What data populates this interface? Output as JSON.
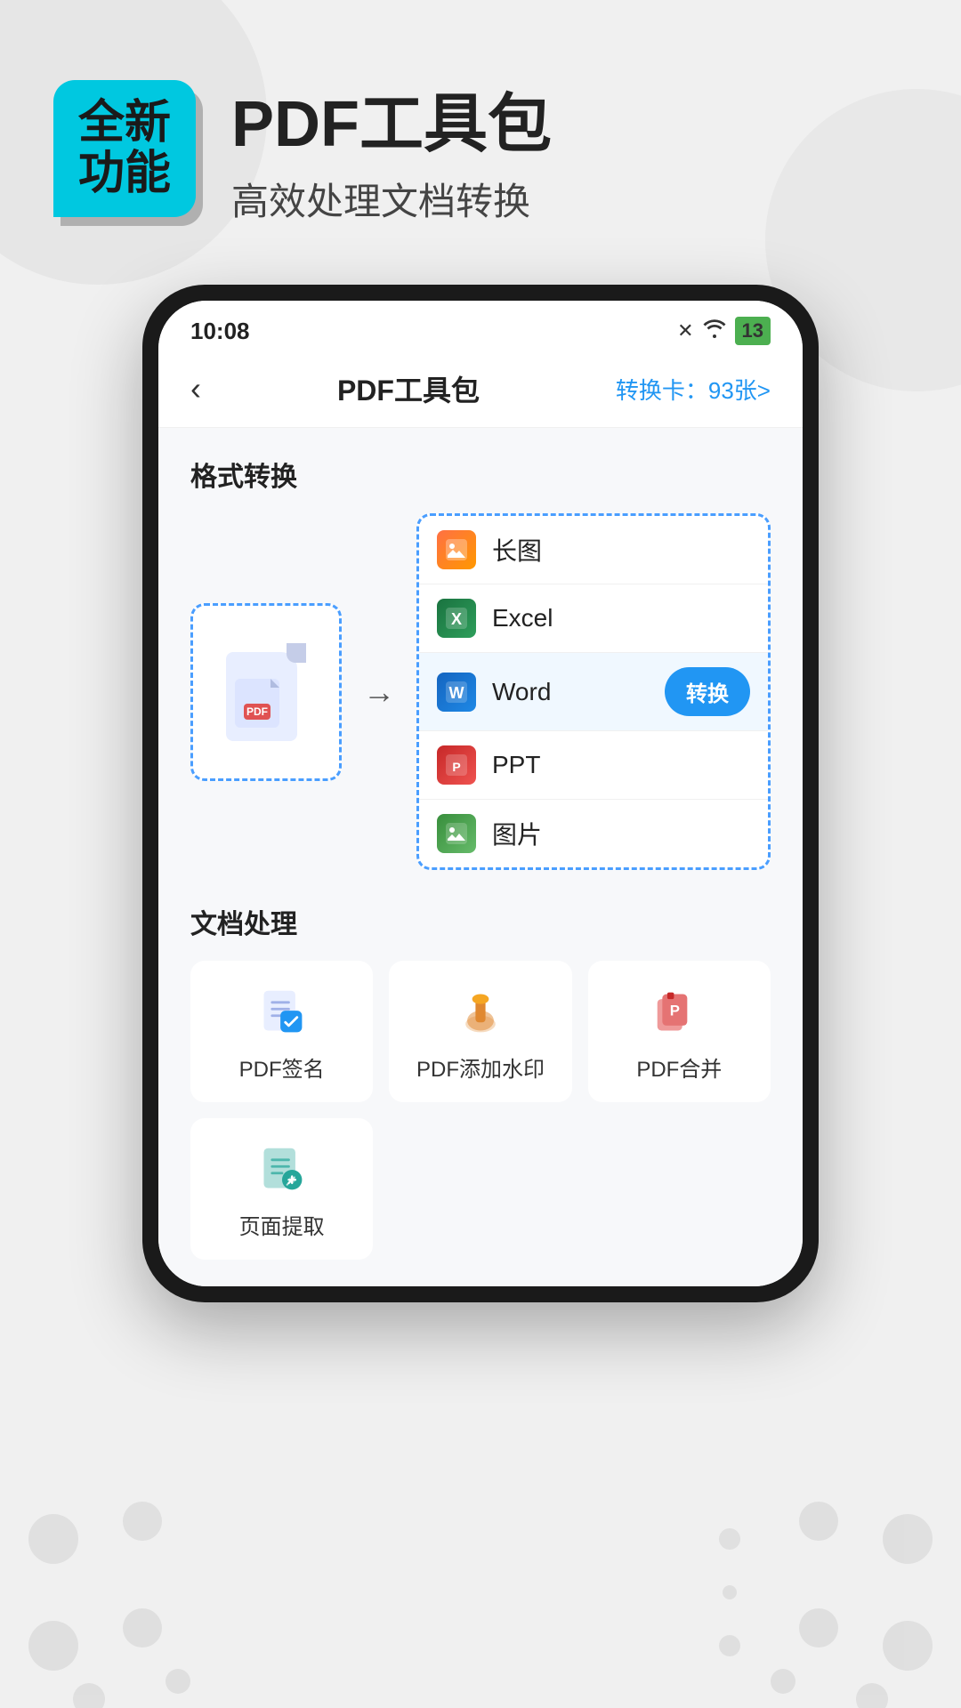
{
  "background": {
    "color": "#efefef"
  },
  "header": {
    "badge_line1": "全新",
    "badge_line2": "功能",
    "title": "PDF工具包",
    "subtitle": "高效处理文档转换"
  },
  "status_bar": {
    "time": "10:08",
    "battery": "13"
  },
  "nav": {
    "back_label": "‹",
    "title": "PDF工具包",
    "action": "转换卡：93张>"
  },
  "format_section": {
    "title": "格式转换",
    "source_label": "PDF",
    "formats": [
      {
        "id": "image",
        "name": "长图",
        "icon_type": "image"
      },
      {
        "id": "excel",
        "name": "Excel",
        "icon_type": "excel"
      },
      {
        "id": "word",
        "name": "Word",
        "icon_type": "word",
        "active": true,
        "action": "转换"
      },
      {
        "id": "ppt",
        "name": "PPT",
        "icon_type": "ppt"
      },
      {
        "id": "picture",
        "name": "图片",
        "icon_type": "picture"
      }
    ]
  },
  "doc_section": {
    "title": "文档处理",
    "tools": [
      {
        "id": "sign",
        "name": "PDF签名",
        "icon_type": "sign"
      },
      {
        "id": "watermark",
        "name": "PDF添加水印",
        "icon_type": "watermark"
      },
      {
        "id": "merge",
        "name": "PDF合并",
        "icon_type": "merge"
      }
    ],
    "tools_row2": [
      {
        "id": "extract",
        "name": "页面提取",
        "icon_type": "extract"
      }
    ]
  }
}
